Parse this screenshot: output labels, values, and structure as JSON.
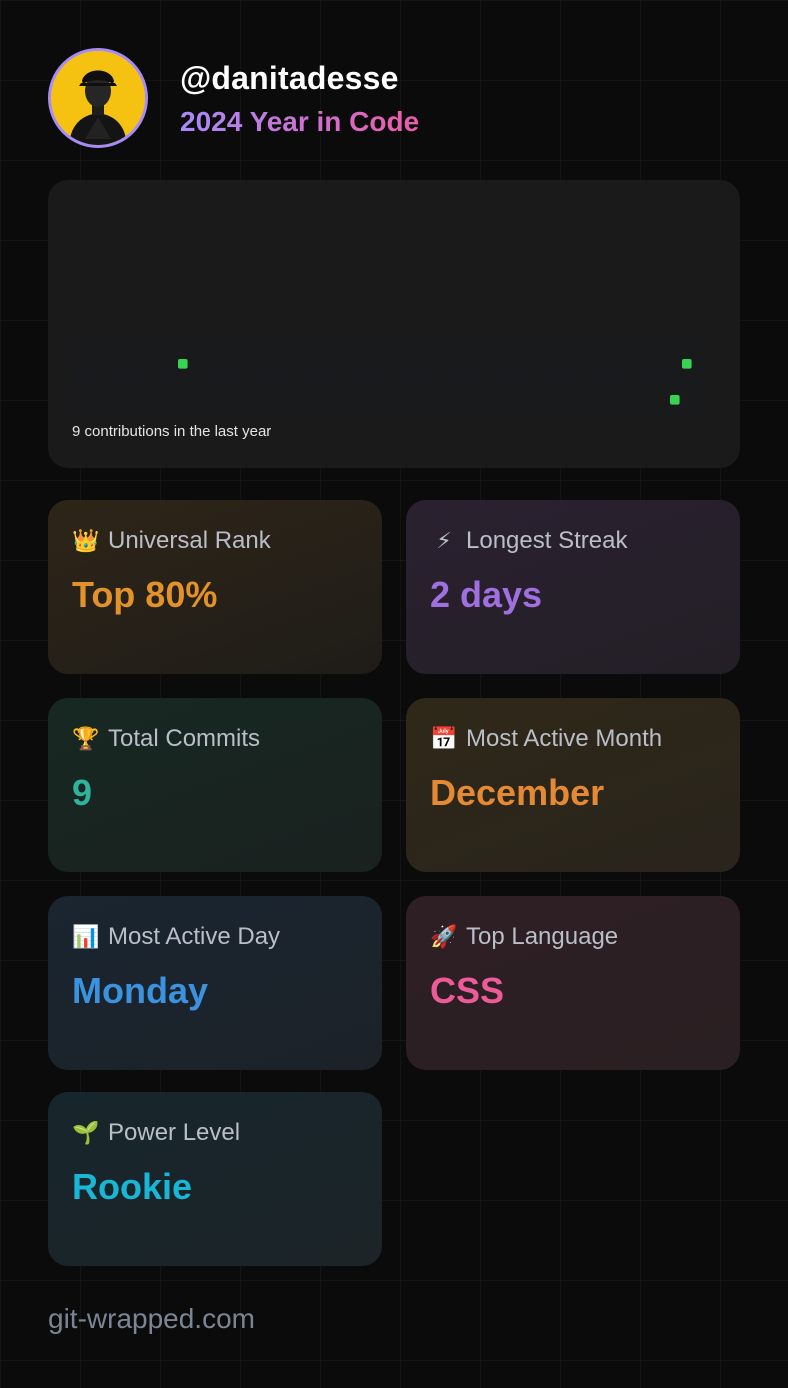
{
  "profile": {
    "username": "@danitadesse",
    "subtitle": "2024 Year in Code",
    "avatar_icon": "profile-photo"
  },
  "contributions": {
    "caption": "9 contributions in the last year",
    "empty_color": "#161b22",
    "active_color": "#39d353",
    "weeks": 53,
    "active_cells": [
      {
        "week": 9,
        "day": 2
      },
      {
        "week": 51,
        "day": 2
      },
      {
        "week": 50,
        "day": 5
      }
    ]
  },
  "stats": [
    {
      "key": "rank",
      "icon": "crown-icon",
      "emoji": "👑",
      "label": "Universal Rank",
      "value": "Top 80%"
    },
    {
      "key": "streak",
      "icon": "lightning-icon",
      "emoji": "⚡",
      "label": "Longest Streak",
      "value": "2 days"
    },
    {
      "key": "commits",
      "icon": "trophy-icon",
      "emoji": "🏆",
      "label": "Total Commits",
      "value": "9"
    },
    {
      "key": "month",
      "icon": "calendar-icon",
      "emoji": "📅",
      "label": "Most Active Month",
      "value": "December"
    },
    {
      "key": "day",
      "icon": "bar-chart-icon",
      "emoji": "📊",
      "label": "Most Active Day",
      "value": "Monday"
    },
    {
      "key": "lang",
      "icon": "rocket-icon",
      "emoji": "🚀",
      "label": "Top Language",
      "value": "CSS"
    },
    {
      "key": "power",
      "icon": "seedling-icon",
      "emoji": "🌱",
      "label": "Power Level",
      "value": "Rookie"
    }
  ],
  "footer": {
    "site": "git-wrapped.com"
  }
}
